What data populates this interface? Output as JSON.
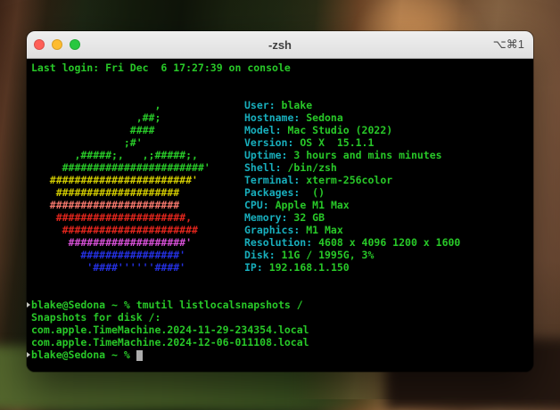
{
  "window": {
    "title": "-zsh",
    "shortcut": "⌥⌘1",
    "controls": [
      {
        "name": "close",
        "color": "#ff5f57"
      },
      {
        "name": "minimize",
        "color": "#febc2e"
      },
      {
        "name": "zoom",
        "color": "#28c840"
      }
    ]
  },
  "terminal": {
    "last_login": "Last login: Fri Dec  6 17:27:39 on console",
    "palette": {
      "green": "#28c828",
      "cyan": "#18aebc",
      "yellow": "#cfc900",
      "salmon": "#f4776c",
      "red": "#e0251c",
      "magenta": "#d44fd4",
      "blue": "#2430e0",
      "cursor": "#acacac",
      "marker": "#c2c4bd",
      "background": "#000000"
    },
    "ascii_logo": [
      {
        "color": "green",
        "text": "                    ,"
      },
      {
        "color": "green",
        "text": "                 ,##;"
      },
      {
        "color": "green",
        "text": "                ####"
      },
      {
        "color": "green",
        "text": "               ;#'"
      },
      {
        "color": "green",
        "text": "       ,#####;,   ,;#####;,"
      },
      {
        "color": "green",
        "text": "     #######################'"
      },
      {
        "color": "yellow",
        "text": "   #######################'"
      },
      {
        "color": "yellow",
        "text": "    ####################"
      },
      {
        "color": "salmon",
        "text": "   #####################"
      },
      {
        "color": "red",
        "text": "    #####################,"
      },
      {
        "color": "red",
        "text": "     ######################"
      },
      {
        "color": "magenta",
        "text": "      ###################'"
      },
      {
        "color": "blue",
        "text": "        ################'"
      },
      {
        "color": "blue",
        "text": "         '####''''''####'"
      }
    ],
    "info": [
      {
        "label": "User:",
        "value": "blake"
      },
      {
        "label": "Hostname:",
        "value": "Sedona"
      },
      {
        "label": "Model:",
        "value": "Mac Studio (2022)"
      },
      {
        "label": "Version:",
        "value": "OS X  15.1.1"
      },
      {
        "label": "Uptime:",
        "value": "3 hours and mins minutes"
      },
      {
        "label": "Shell:",
        "value": "/bin/zsh"
      },
      {
        "label": "Terminal:",
        "value": "xterm-256color"
      },
      {
        "label": "Packages:",
        "value": " ()"
      },
      {
        "label": "CPU:",
        "value": "Apple M1 Max"
      },
      {
        "label": "Memory:",
        "value": "32 GB"
      },
      {
        "label": "Graphics:",
        "value": "M1 Max"
      },
      {
        "label": "Resolution:",
        "value": "4608 x 4096 1200 x 1600"
      },
      {
        "label": "Disk:",
        "value": "11G / 1995G, 3%"
      },
      {
        "label": "IP:",
        "value": "192.168.1.150"
      }
    ],
    "session": [
      {
        "marker": true,
        "cursor": false,
        "text": "blake@Sedona ~ % tmutil listlocalsnapshots /"
      },
      {
        "marker": false,
        "cursor": false,
        "text": "Snapshots for disk /:"
      },
      {
        "marker": false,
        "cursor": false,
        "text": "com.apple.TimeMachine.2024-11-29-234354.local"
      },
      {
        "marker": false,
        "cursor": false,
        "text": "com.apple.TimeMachine.2024-12-06-011108.local"
      },
      {
        "marker": true,
        "cursor": true,
        "text": "blake@Sedona ~ % "
      }
    ]
  }
}
